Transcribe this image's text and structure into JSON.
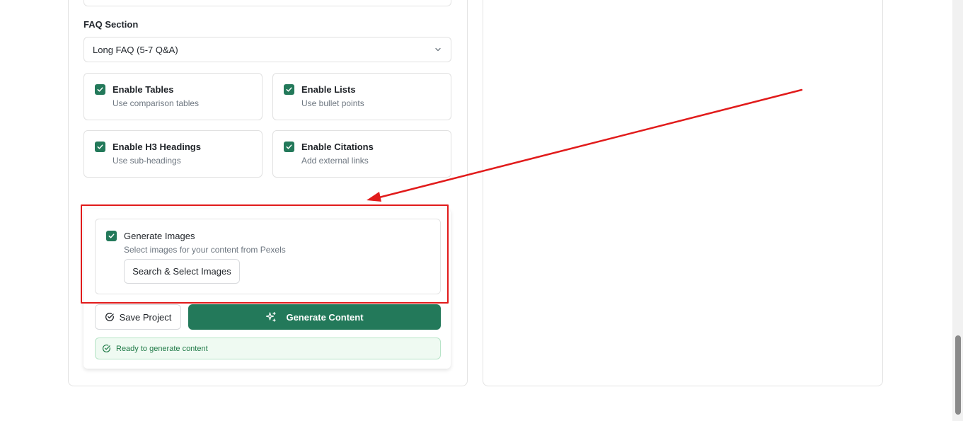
{
  "faq": {
    "label": "FAQ Section",
    "selected": "Long FAQ (5-7 Q&A)"
  },
  "options": [
    {
      "title": "Enable Tables",
      "sub": "Use comparison tables",
      "checked": true
    },
    {
      "title": "Enable Lists",
      "sub": "Use bullet points",
      "checked": true
    },
    {
      "title": "Enable H3 Headings",
      "sub": "Use sub-headings",
      "checked": true
    },
    {
      "title": "Enable Citations",
      "sub": "Add external links",
      "checked": true
    }
  ],
  "images": {
    "title": "Generate Images",
    "sub": "Select images for your content from Pexels",
    "checked": true,
    "button": "Search & Select Images"
  },
  "actions": {
    "save": "Save Project",
    "generate": "Generate Content"
  },
  "status": "Ready to generate content",
  "colors": {
    "accent": "#23795a",
    "annotation": "#e11b1b",
    "status_bg": "#effaf2",
    "status_text": "#1f7a47"
  },
  "icons": {
    "select": "chevron-down-icon",
    "checkbox": "check-icon",
    "save": "circle-check-icon",
    "generate": "sparkles-icon",
    "status": "circle-check-icon"
  }
}
